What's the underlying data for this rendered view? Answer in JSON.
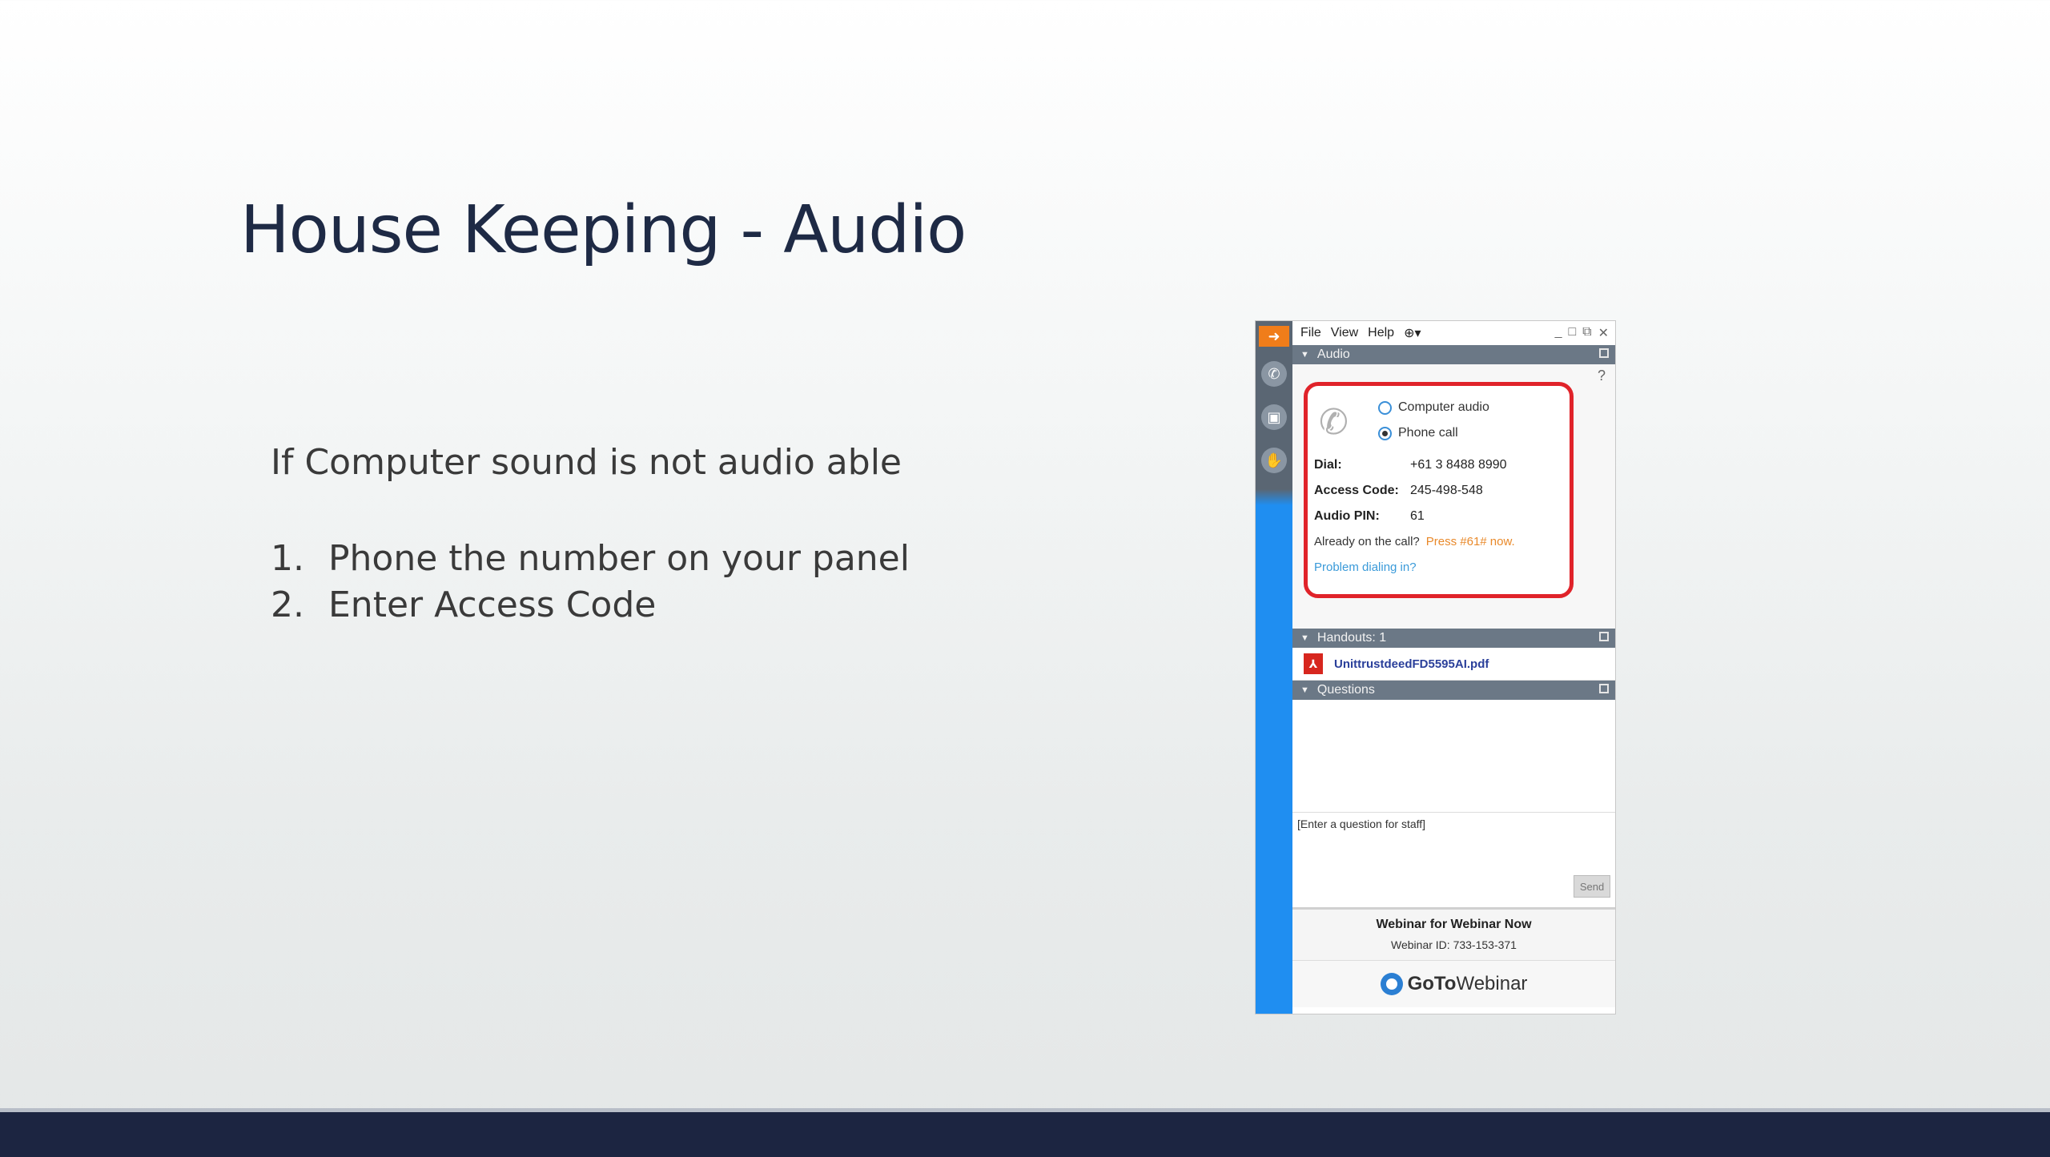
{
  "slide": {
    "title": "House Keeping - Audio",
    "intro": "If Computer sound is not audio able",
    "steps": [
      {
        "num": "1.",
        "text": "Phone the number on your panel"
      },
      {
        "num": "2.",
        "text": "Enter Access Code"
      }
    ]
  },
  "panel": {
    "menu": [
      "File",
      "View",
      "Help"
    ],
    "audio": {
      "header": "Audio",
      "help": "?",
      "options": [
        "Computer audio",
        "Phone call"
      ],
      "selected": "Phone call",
      "dial_label": "Dial:",
      "dial_value": "+61 3 8488 8990",
      "access_label": "Access Code:",
      "access_value": "245-498-548",
      "pin_label": "Audio PIN:",
      "pin_value": "61",
      "already": "Already on the call?",
      "press": "Press #61# now.",
      "problem": "Problem dialing in?"
    },
    "handouts": {
      "header": "Handouts: 1",
      "file": "UnittrustdeedFD5595AI.pdf"
    },
    "questions": {
      "header": "Questions",
      "placeholder": "[Enter a question for staff]",
      "send": "Send"
    },
    "webinar": {
      "title": "Webinar for Webinar Now",
      "id": "Webinar ID: 733-153-371"
    },
    "brand": {
      "part1": "GoTo",
      "part2": "Webinar"
    }
  },
  "colors": {
    "title": "#1e2a45",
    "bottom_bar": "#1c2541",
    "panel_side": "#1f8ef1",
    "highlight_box": "#e0232a",
    "press_code": "#e9892a",
    "link": "#3a9ad9"
  }
}
